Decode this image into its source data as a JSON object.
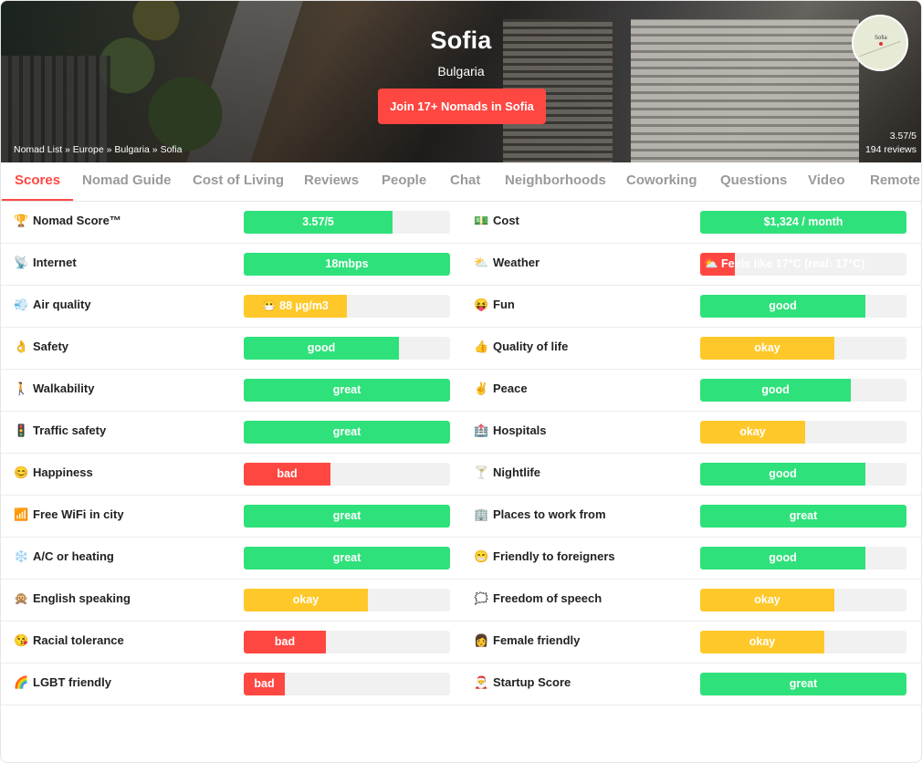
{
  "colors": {
    "accent": "#ff4742",
    "good": "#2fe17a",
    "okay": "#ffc82a",
    "bad": "#ff4742"
  },
  "hero": {
    "city": "Sofia",
    "country": "Bulgaria",
    "join_label": "Join 17+ Nomads in Sofia",
    "breadcrumb": [
      "Nomad List",
      "Europe",
      "Bulgaria",
      "Sofia"
    ],
    "rating": "3.57/5",
    "reviews": "194 reviews",
    "map_label": "Sofia"
  },
  "tabs": [
    {
      "label": "Scores",
      "active": true
    },
    {
      "label": "Nomad Guide"
    },
    {
      "label": "Cost of Living"
    },
    {
      "label": "Reviews"
    },
    {
      "label": "People"
    },
    {
      "label": "Chat"
    },
    {
      "label": "Neighborhoods"
    },
    {
      "label": "Coworking"
    },
    {
      "label": "Questions"
    },
    {
      "label": "Video"
    },
    {
      "label": "Remote"
    }
  ],
  "scores": [
    {
      "left": {
        "icon": "🏆",
        "icon_name": "trophy-icon",
        "label": "Nomad Score™",
        "value": "3.57/5",
        "color": "green",
        "level": 0.72
      },
      "right": {
        "icon": "💵",
        "icon_name": "money-icon",
        "label": "Cost",
        "value": "$1,324 / month",
        "color": "green",
        "level": 1.0
      }
    },
    {
      "left": {
        "icon": "📡",
        "icon_name": "satellite-icon",
        "label": "Internet",
        "value": "18mbps",
        "color": "green",
        "level": 1.0
      },
      "right": {
        "icon": "⛅",
        "icon_name": "partly-cloudy-icon",
        "label": "Weather",
        "value": "⛅ Feels like 17°C (real: 17°C)",
        "color": "red",
        "level": 0.17
      }
    },
    {
      "left": {
        "icon": "💨",
        "icon_name": "wind-icon",
        "label": "Air quality",
        "value": "😷 88 µg/m3",
        "color": "yellow",
        "level": 0.5
      },
      "right": {
        "icon": "😝",
        "icon_name": "fun-face-icon",
        "label": "Fun",
        "value": "good",
        "color": "green",
        "level": 0.8
      }
    },
    {
      "left": {
        "icon": "👌",
        "icon_name": "ok-hand-icon",
        "label": "Safety",
        "value": "good",
        "color": "green",
        "level": 0.75
      },
      "right": {
        "icon": "👍",
        "icon_name": "thumbs-up-icon",
        "label": "Quality of life",
        "value": "okay",
        "color": "yellow",
        "level": 0.65
      }
    },
    {
      "left": {
        "icon": "🚶",
        "icon_name": "walking-icon",
        "label": "Walkability",
        "value": "great",
        "color": "green",
        "level": 1.0
      },
      "right": {
        "icon": "✌️",
        "icon_name": "peace-hand-icon",
        "label": "Peace",
        "value": "good",
        "color": "green",
        "level": 0.73
      }
    },
    {
      "left": {
        "icon": "🚦",
        "icon_name": "traffic-light-icon",
        "label": "Traffic safety",
        "value": "great",
        "color": "green",
        "level": 1.0
      },
      "right": {
        "icon": "🏥",
        "icon_name": "hospital-icon",
        "label": "Hospitals",
        "value": "okay",
        "color": "yellow",
        "level": 0.51
      }
    },
    {
      "left": {
        "icon": "😊",
        "icon_name": "smile-icon",
        "label": "Happiness",
        "value": "bad",
        "color": "red",
        "level": 0.42
      },
      "right": {
        "icon": "🍸",
        "icon_name": "cocktail-icon",
        "label": "Nightlife",
        "value": "good",
        "color": "green",
        "level": 0.8
      }
    },
    {
      "left": {
        "icon": "📶",
        "icon_name": "wifi-signal-icon",
        "label": "Free WiFi in city",
        "value": "great",
        "color": "green",
        "level": 1.0
      },
      "right": {
        "icon": "🏢",
        "icon_name": "office-icon",
        "label": "Places to work from",
        "value": "great",
        "color": "green",
        "level": 1.0
      }
    },
    {
      "left": {
        "icon": "❄️",
        "icon_name": "snowflake-icon",
        "label": "A/C or heating",
        "value": "great",
        "color": "green",
        "level": 1.0
      },
      "right": {
        "icon": "😁",
        "icon_name": "grin-icon",
        "label": "Friendly to foreigners",
        "value": "good",
        "color": "green",
        "level": 0.8
      }
    },
    {
      "left": {
        "icon": "🙊",
        "icon_name": "speak-no-evil-icon",
        "label": "English speaking",
        "value": "okay",
        "color": "yellow",
        "level": 0.6
      },
      "right": {
        "icon": "🗯️",
        "icon_name": "speech-bubble-icon",
        "label": "Freedom of speech",
        "value": "okay",
        "color": "yellow",
        "level": 0.65
      }
    },
    {
      "left": {
        "icon": "😘",
        "icon_name": "kiss-face-icon",
        "label": "Racial tolerance",
        "value": "bad",
        "color": "red",
        "level": 0.4
      },
      "right": {
        "icon": "👩",
        "icon_name": "woman-icon",
        "label": "Female friendly",
        "value": "okay",
        "color": "yellow",
        "level": 0.6
      }
    },
    {
      "left": {
        "icon": "🌈",
        "icon_name": "rainbow-icon",
        "label": "LGBT friendly",
        "value": "bad",
        "color": "red",
        "level": 0.2
      },
      "right": {
        "icon": "🎅",
        "icon_name": "santa-icon",
        "label": "Startup Score",
        "value": "great",
        "color": "green",
        "level": 1.0
      }
    }
  ]
}
